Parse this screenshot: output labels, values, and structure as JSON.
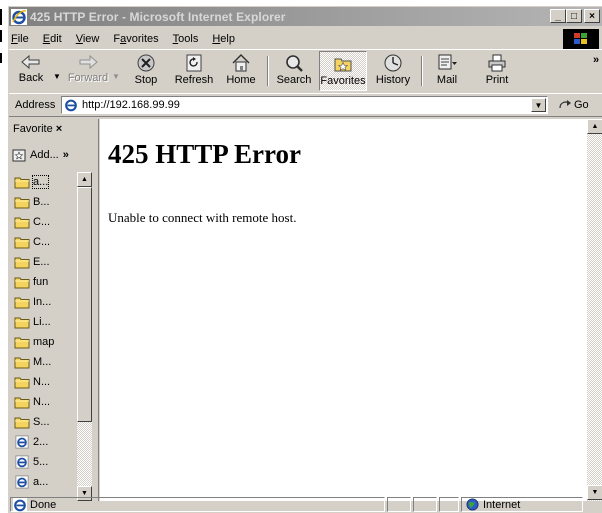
{
  "window": {
    "title": "425 HTTP Error - Microsoft Internet Explorer",
    "minimize_glyph": "_",
    "maximize_glyph": "□",
    "close_glyph": "×"
  },
  "menu": {
    "items": [
      {
        "label": "File",
        "mnemonic": "F",
        "rest": "ile"
      },
      {
        "label": "Edit",
        "mnemonic": "E",
        "rest": "dit"
      },
      {
        "label": "View",
        "mnemonic": "V",
        "rest": "iew"
      },
      {
        "label": "Favorites",
        "mnemonic": "a",
        "pre": "F",
        "rest": "vorites"
      },
      {
        "label": "Tools",
        "mnemonic": "T",
        "rest": "ools"
      },
      {
        "label": "Help",
        "mnemonic": "H",
        "rest": "elp"
      }
    ]
  },
  "toolbar": {
    "back": "Back",
    "forward": "Forward",
    "stop": "Stop",
    "refresh": "Refresh",
    "home": "Home",
    "search": "Search",
    "favorites": "Favorites",
    "history": "History",
    "mail": "Mail",
    "print": "Print",
    "chevron": "»"
  },
  "address": {
    "label": "Address",
    "url": "http://192.168.99.99",
    "go": "Go"
  },
  "favorites_pane": {
    "title": "Favorite",
    "close": "×",
    "add": "Add...",
    "more": "»",
    "items": [
      {
        "label": "a...",
        "type": "folder",
        "selected": true
      },
      {
        "label": "B...",
        "type": "folder"
      },
      {
        "label": "C...",
        "type": "folder"
      },
      {
        "label": "C...",
        "type": "folder"
      },
      {
        "label": "E...",
        "type": "folder"
      },
      {
        "label": "fun",
        "type": "folder"
      },
      {
        "label": "In...",
        "type": "folder"
      },
      {
        "label": "Li...",
        "type": "folder"
      },
      {
        "label": "map",
        "type": "folder"
      },
      {
        "label": "M...",
        "type": "folder"
      },
      {
        "label": "N...",
        "type": "folder"
      },
      {
        "label": "N...",
        "type": "folder"
      },
      {
        "label": "S...",
        "type": "folder"
      },
      {
        "label": "2...",
        "type": "page"
      },
      {
        "label": "5...",
        "type": "page"
      },
      {
        "label": "a...",
        "type": "page"
      }
    ]
  },
  "page": {
    "heading": "425 HTTP Error",
    "message": "Unable to connect with remote host."
  },
  "status": {
    "text": "Done",
    "zone": "Internet"
  },
  "colors": {
    "face": "#d4d0c8",
    "title_inactive_start": "#808080",
    "title_inactive_end": "#b5b5b5",
    "folder": "#f4d35e",
    "ie_blue": "#1e4fa3"
  }
}
